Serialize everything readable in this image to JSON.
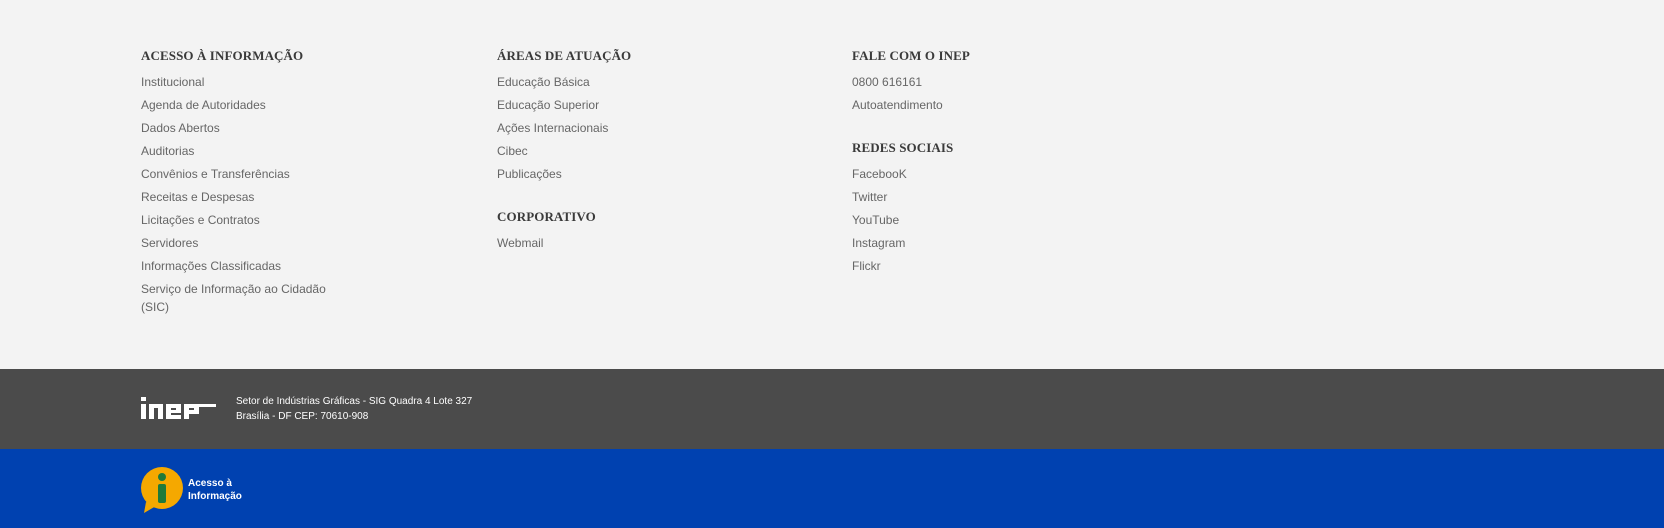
{
  "footer": {
    "columns": [
      {
        "sections": [
          {
            "title": "ACESSO À INFORMAÇÃO",
            "links": [
              "Institucional",
              "Agenda de Autoridades",
              "Dados Abertos",
              "Auditorias",
              "Convênios e Transferências",
              "Receitas e Despesas",
              "Licitações e Contratos",
              "Servidores",
              "Informações Classificadas",
              "Serviço de Informação ao Cidadão (SIC)"
            ]
          }
        ]
      },
      {
        "sections": [
          {
            "title": "ÁREAS DE ATUAÇÃO",
            "links": [
              "Educação Básica",
              "Educação Superior",
              "Ações Internacionais",
              "Cibec",
              "Publicações"
            ]
          },
          {
            "title": "CORPORATIVO",
            "links": [
              "Webmail"
            ]
          }
        ]
      },
      {
        "sections": [
          {
            "title": "FALE COM O INEP",
            "links": [
              "0800 616161",
              "Autoatendimento"
            ]
          },
          {
            "title": "REDES SOCIAIS",
            "links": [
              "FacebooK",
              "Twitter",
              "YouTube",
              "Instagram",
              "Flickr"
            ]
          }
        ]
      }
    ]
  },
  "address_bar": {
    "logo_text": "inep",
    "address_line1": "Setor de Indústrias Gráficas - SIG Quadra 4 Lote 327",
    "address_line2": "Brasília - DF CEP: 70610-908",
    "background": "#4b4b4b"
  },
  "gov_bar": {
    "access_label_line1": "Acesso à",
    "access_label_line2": "Informação",
    "icon": "access-to-information-icon",
    "background": "#0041b0",
    "badge_color": "#f5a800",
    "badge_i_color": "#1f7a3a"
  }
}
